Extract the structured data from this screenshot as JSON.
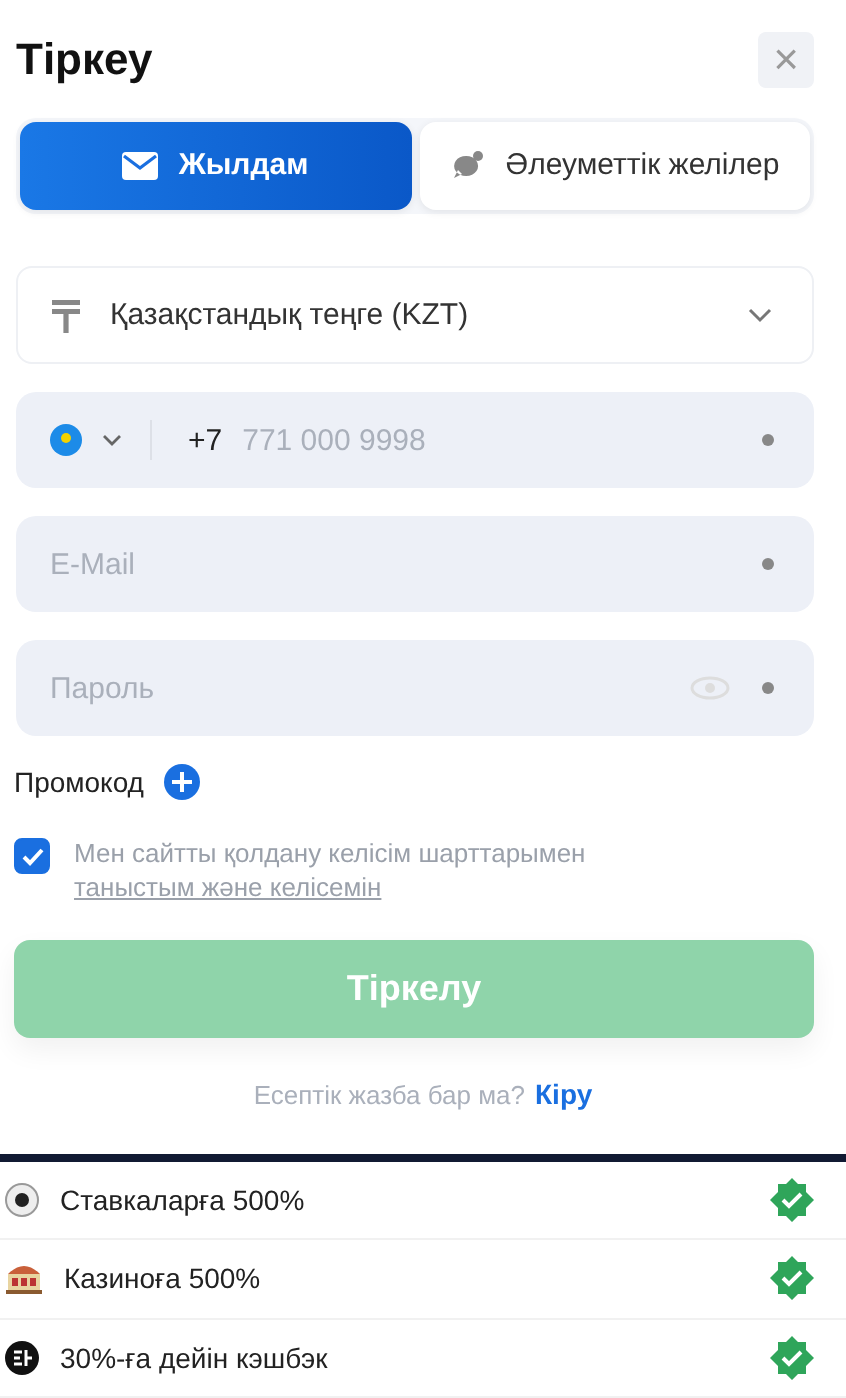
{
  "title": "Тіркеу",
  "close_button": {
    "label": "×"
  },
  "tabs": [
    {
      "label": "Жылдам",
      "kind": "mail",
      "selected": true
    },
    {
      "label": "Әлеуметтік желілер",
      "kind": "chat",
      "selected": false
    }
  ],
  "currency_select": {
    "value": "Қазақстандық теңге (KZT)"
  },
  "fields": [
    {
      "kind": "phone",
      "prefix": "+7",
      "placeholder": "771 000 9998",
      "required": true
    },
    {
      "kind": "text",
      "placeholder": "E-Mail",
      "required": true
    },
    {
      "kind": "password",
      "placeholder": "Пароль",
      "required": true
    }
  ],
  "promo": {
    "label": "Промокод"
  },
  "agreement": {
    "checked": true,
    "text": "Мен сайтты қолдану келісім шарттарымен",
    "link": "таныстым және келісемін"
  },
  "submit_button": {
    "label": "Тіркелу",
    "disabled": true
  },
  "login_prompt": {
    "text": "Есептік жазба бар ма?",
    "link": "Кіру"
  },
  "bonuses": [
    {
      "kind": "ball",
      "label": "Ставкаларға 500%",
      "checked": true
    },
    {
      "kind": "casino",
      "label": "Казиноға 500%",
      "checked": true
    },
    {
      "kind": "cash",
      "label": "30%-ға дейін кэшбэк",
      "checked": true
    }
  ]
}
